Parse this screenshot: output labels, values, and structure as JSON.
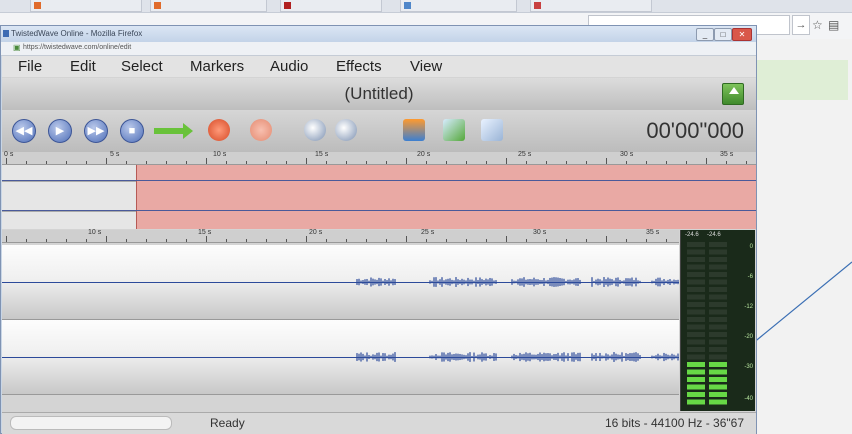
{
  "window": {
    "title": "TwistedWave Online - Mozilla Firefox",
    "url": "https://twistedwave.com/online/edit",
    "buttons": {
      "minimize": "_",
      "maximize": "□",
      "close": "✕"
    }
  },
  "menu": [
    "File",
    "Edit",
    "Select",
    "Markers",
    "Audio",
    "Effects",
    "View"
  ],
  "document_title": "(Untitled)",
  "timecode": "00'00\"000",
  "toolbar_icons": [
    "rewind-icon",
    "play-icon",
    "fast-forward-icon",
    "stop-icon",
    "green-arrow-icon",
    "undo-icon",
    "redo-icon",
    "zoom-in-icon",
    "zoom-out-icon",
    "fit-icon",
    "normalize-icon",
    "trim-icon"
  ],
  "ruler_top": [
    "0 s",
    "5 s",
    "10 s",
    "15 s",
    "20 s",
    "25 s",
    "30 s",
    "35 s"
  ],
  "ruler_tracks": [
    "10 s",
    "15 s",
    "20 s",
    "25 s",
    "30 s",
    "35 s"
  ],
  "vu_meter": {
    "labels": [
      "-24.6",
      "-24.6"
    ],
    "scale": [
      "0",
      "-6",
      "-12",
      "-20",
      "-30",
      "-40"
    ]
  },
  "status": {
    "text": "Ready",
    "info": "16 bits - 44100 Hz - 36\"67"
  },
  "colors": {
    "selection": "#e9a9a4",
    "waveform": "#2c4a9a",
    "meter_green": "#67d846"
  }
}
